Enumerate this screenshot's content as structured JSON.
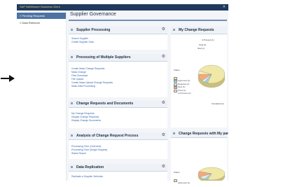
{
  "window": {
    "title": "SAP NetWeaver Business Client",
    "close": "✕"
  },
  "sidebar": {
    "items": [
      {
        "label": "» Pending Requests"
      },
      {
        "label": "» Data Retriever"
      }
    ]
  },
  "page_title": "Supplier Governance",
  "panels": {
    "supplier_processing": {
      "title": "Supplier Processing",
      "links": [
        "Search Supplier",
        "Create Supplier Data"
      ]
    },
    "multiple": {
      "title": "Processing of Multiple Suppliers",
      "links": [
        "Create Mass Change Requests",
        "Mass Change",
        "Files Download",
        "File Upload",
        "Create Mass Upload Change Requests",
        "Mass Data Processing"
      ]
    },
    "change_requests": {
      "title": "Change Requests and Documents",
      "links": [
        "My Change Requests",
        "Display Change Requests",
        "Display Change Documents"
      ]
    },
    "analysis": {
      "title": "Analysis of Change Request Process",
      "links": [
        "Processing Time (Overview)",
        "Processing Time (Single Request)",
        "Status Report"
      ]
    },
    "replication": {
      "title": "Data Replication",
      "links": [
        "Replicate a Supplier Selection"
      ]
    },
    "my_requests": {
      "title": "My Change Requests",
      "legend_title": "Status",
      "legend": [
        "Approved (1)",
        "Rejected (1)",
        "New (1)",
        "Final (1)",
        "In Process (1)"
      ],
      "slice_labels": [
        "Completed (1)",
        "New (1)",
        "Final (1)",
        "In Process (1)"
      ]
    },
    "participation": {
      "title": "Change Requests with My participation",
      "legend_title": "Status",
      "legend": [
        "Approved (1)"
      ]
    }
  },
  "chart_data": [
    {
      "type": "pie",
      "title": "My Change Requests",
      "categories": [
        "Completed",
        "Rejected",
        "New",
        "Final",
        "In Process"
      ],
      "values": [
        74,
        4,
        4,
        12,
        6
      ],
      "colors": [
        "#efe8a6",
        "#9fd6d2",
        "#dfe9f3",
        "#f4a97a",
        "#f6f0b8"
      ]
    },
    {
      "type": "pie",
      "title": "Change Requests with My participation",
      "categories": [
        "Completed",
        "Rejected",
        "New",
        "Final"
      ],
      "values": [
        74,
        4,
        8,
        14
      ],
      "colors": [
        "#efe8a6",
        "#9fd6d2",
        "#dfe9f3",
        "#f4a97a"
      ]
    }
  ]
}
